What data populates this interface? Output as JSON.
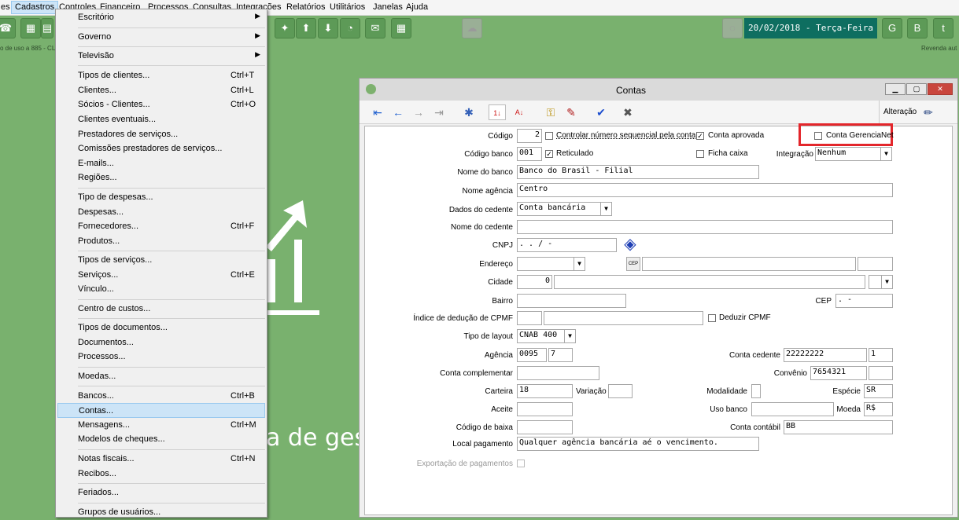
{
  "menubar": {
    "items": [
      "es",
      "Cadastros",
      "Controles",
      "Financeiro",
      "Processos",
      "Consultas",
      "Integrações",
      "Relatórios",
      "Utilitários",
      "Janelas",
      "Ajuda"
    ]
  },
  "status": {
    "date": "20/02/2018 - Terça-Feira",
    "left_text": "o de uso a 885 - CL",
    "right_text": "Revenda aut"
  },
  "background": {
    "tagline": "a de ges"
  },
  "dropdown": {
    "items": [
      {
        "label": "Escritório",
        "shortcut": "",
        "submenu": true
      },
      {
        "label": "Governo",
        "shortcut": "",
        "submenu": true
      },
      {
        "label": "Televisão",
        "shortcut": "",
        "submenu": true
      },
      {
        "label": "Tipos de clientes...",
        "shortcut": "Ctrl+T"
      },
      {
        "label": "Clientes...",
        "shortcut": "Ctrl+L"
      },
      {
        "label": "Sócios - Clientes...",
        "shortcut": "Ctrl+O"
      },
      {
        "label": "Clientes eventuais...",
        "shortcut": ""
      },
      {
        "label": "Prestadores de serviços...",
        "shortcut": ""
      },
      {
        "label": "Comissões prestadores de serviços...",
        "shortcut": ""
      },
      {
        "label": "E-mails...",
        "shortcut": ""
      },
      {
        "label": "Regiões...",
        "shortcut": ""
      },
      {
        "label": "Tipo de despesas...",
        "shortcut": ""
      },
      {
        "label": "Despesas...",
        "shortcut": ""
      },
      {
        "label": "Fornecedores...",
        "shortcut": "Ctrl+F"
      },
      {
        "label": "Produtos...",
        "shortcut": ""
      },
      {
        "label": "Tipos de serviços...",
        "shortcut": ""
      },
      {
        "label": "Serviços...",
        "shortcut": "Ctrl+E"
      },
      {
        "label": "Vínculo...",
        "shortcut": ""
      },
      {
        "label": "Centro de custos...",
        "shortcut": ""
      },
      {
        "label": "Tipos de documentos...",
        "shortcut": ""
      },
      {
        "label": "Documentos...",
        "shortcut": ""
      },
      {
        "label": "Processos...",
        "shortcut": ""
      },
      {
        "label": "Moedas...",
        "shortcut": ""
      },
      {
        "label": "Bancos...",
        "shortcut": "Ctrl+B"
      },
      {
        "label": "Contas...",
        "shortcut": ""
      },
      {
        "label": "Mensagens...",
        "shortcut": "Ctrl+M"
      },
      {
        "label": "Modelos de cheques...",
        "shortcut": ""
      },
      {
        "label": "Notas fiscais...",
        "shortcut": "Ctrl+N"
      },
      {
        "label": "Recibos...",
        "shortcut": ""
      },
      {
        "label": "Feriados...",
        "shortcut": ""
      },
      {
        "label": "Grupos de usuários...",
        "shortcut": ""
      }
    ]
  },
  "window": {
    "title": "Contas",
    "mode_label": "Alteração",
    "labels": {
      "codigo": "Código",
      "codigo_banco": "Código banco",
      "nome_banco": "Nome do banco",
      "nome_agencia": "Nome agência",
      "dados_cedente": "Dados do cedente",
      "nome_cedente": "Nome do cedente",
      "cnpj": "CNPJ",
      "endereco": "Endereço",
      "cidade": "Cidade",
      "bairro": "Bairro",
      "cep": "CEP",
      "indice_cpmf": "Índice de dedução de CPMF",
      "tipo_layout": "Tipo de layout",
      "agencia": "Agência",
      "conta_cedente": "Conta cedente",
      "conta_complementar": "Conta complementar",
      "convenio": "Convênio",
      "carteira": "Carteira",
      "variacao": "Variação",
      "modalidade": "Modalidade",
      "especie": "Espécie",
      "aceite": "Aceite",
      "uso_banco": "Uso banco",
      "moeda": "Moeda",
      "codigo_baixa": "Código de baixa",
      "conta_contabil": "Conta contábil",
      "local_pagamento": "Local pagamento",
      "exportacao": "Exportação de pagamentos",
      "integracao": "Integração"
    },
    "checks": {
      "controlar": "Controlar número sequencial pela conta",
      "conta_aprovada": "Conta aprovada",
      "conta_gerencianet": "Conta GerenciaNet",
      "reticulado": "Reticulado",
      "ficha_caixa": "Ficha caixa",
      "deduzir_cpmf": "Deduzir CPMF"
    },
    "values": {
      "codigo": "2",
      "codigo_banco": "001",
      "nome_banco": "Banco do Brasil - Filial",
      "nome_agencia": "Centro",
      "dados_cedente": "Conta bancária",
      "cnpj": " .   .   /    -",
      "cidade_code": "0",
      "cep": " .   -",
      "tipo_layout": "CNAB 400",
      "agencia": "0095",
      "agencia_dv": "7",
      "conta_cedente": "22222222",
      "conta_cedente_dv": "1",
      "convenio": "7654321",
      "carteira": "18",
      "especie": "SR",
      "moeda": "R$",
      "conta_contabil": "BB",
      "local_pagamento": "Qualquer agência bancária aé o vencimento.",
      "integracao": "Nenhum"
    }
  },
  "colors": {
    "background": "#79b16e",
    "highlight": "#e3262b",
    "date_bg": "#0e6e60"
  }
}
